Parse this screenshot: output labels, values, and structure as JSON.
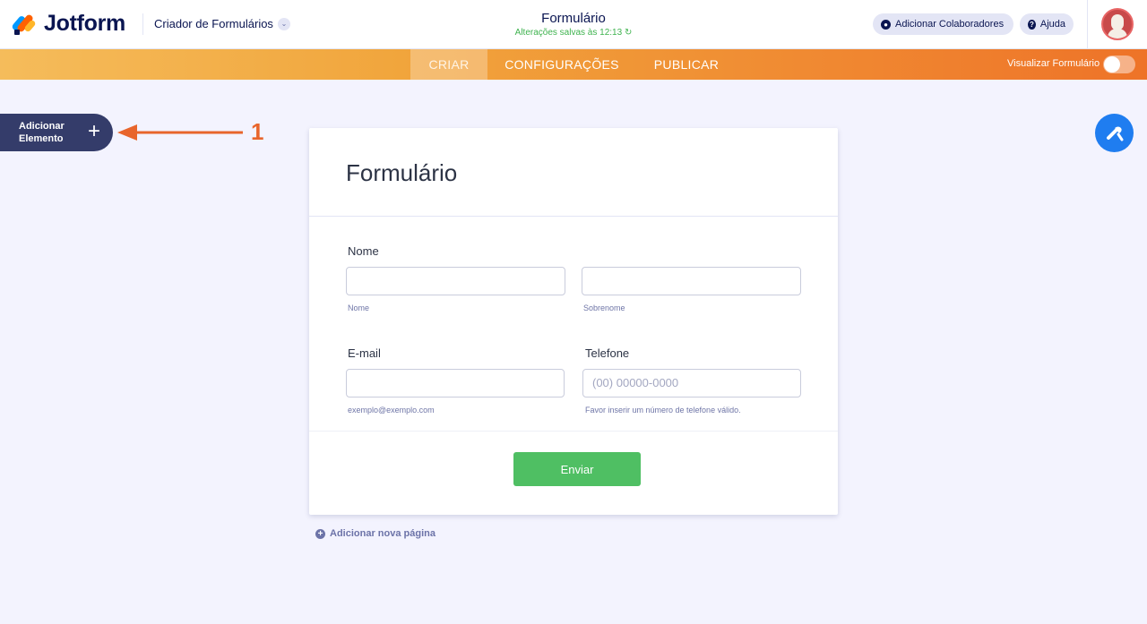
{
  "header": {
    "logo_text": "Jotform",
    "builder_label": "Criador de Formulários",
    "form_title": "Formulário",
    "save_status": "Alterações salvas às 12:13",
    "collaborators_label": "Adicionar Colaboradores",
    "help_label": "Ajuda"
  },
  "nav": {
    "tabs": [
      {
        "label": "CRIAR",
        "active": true
      },
      {
        "label": "CONFIGURAÇÕES",
        "active": false
      },
      {
        "label": "PUBLICAR",
        "active": false
      }
    ],
    "preview_label": "Visualizar Formulário",
    "preview_toggle_on": false
  },
  "sidebar": {
    "add_element_label": "Adicionar Elemento"
  },
  "annotation": {
    "number": "1"
  },
  "form": {
    "title": "Formulário",
    "name_label": "Nome",
    "first_name_sublabel": "Nome",
    "last_name_sublabel": "Sobrenome",
    "email_label": "E-mail",
    "email_sublabel": "exemplo@exemplo.com",
    "phone_label": "Telefone",
    "phone_placeholder": "(00) 00000-0000",
    "phone_sublabel": "Favor inserir um número de telefone válido.",
    "submit_label": "Enviar"
  },
  "footer": {
    "add_page_label": "Adicionar nova página"
  },
  "colors": {
    "navy": "#0a1551",
    "orange_start": "#f5bc5b",
    "orange_end": "#ee7328",
    "submit_green": "#4fbf63",
    "designer_blue": "#1f7df0",
    "save_green": "#3fb34f",
    "annotation_orange": "#e8652c"
  }
}
